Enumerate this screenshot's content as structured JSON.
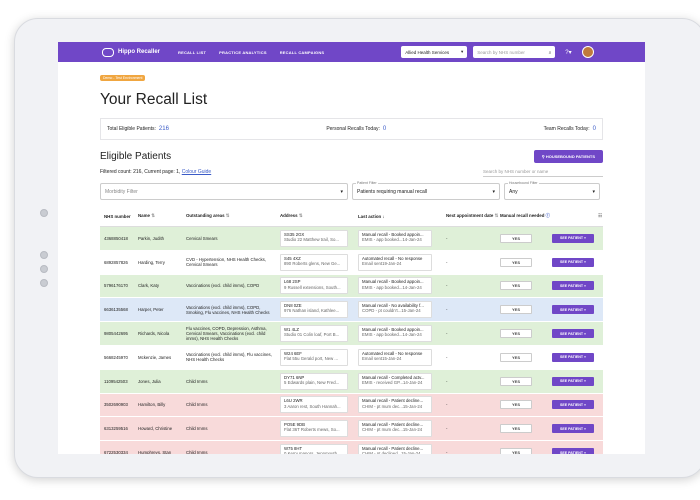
{
  "nav": {
    "brand": "Hippo Recaller",
    "links": [
      "RECALL LIST",
      "PRACTICE ANALYTICS",
      "RECALL CAMPAIGNS"
    ],
    "org": "Allied Health Services",
    "search_placeholder": "Search by NHS number"
  },
  "env": "Demo - Test Environment",
  "title": "Your Recall List",
  "stats": {
    "total_label": "Total Eligible Patients:",
    "total": "216",
    "personal_label": "Personal Recalls Today:",
    "personal": "0",
    "team_label": "Team Recalls Today:",
    "team": "0"
  },
  "eligible": {
    "title": "Eligible Patients",
    "housebound_btn": "HOUSEBOUND PATIENTS",
    "filtered_label": "Filtered count:",
    "filtered": "216",
    "page_label": "Current page:",
    "page": "1",
    "colour_guide": "Colour Guide",
    "table_search_placeholder": "Search by NHS number or name"
  },
  "filters": {
    "morbidity_placeholder": "Morbidity Filter",
    "patient_label": "Patient Filter",
    "patient_value": "Patients requiring manual recall",
    "housebound_label": "Housebound Filter",
    "housebound_value": "Any"
  },
  "columns": {
    "nhs": "NHS number",
    "name": "Name",
    "areas": "Outstanding areas",
    "address": "Address",
    "last_action": "Last action",
    "next_appt": "Next appointment date",
    "manual": "Manual recall needed"
  },
  "colors": {
    "green": "#dff0d8",
    "blue": "#dde8f7",
    "red": "#f8dada",
    "accent": "#7047c7"
  },
  "rows": [
    {
      "color": "green",
      "nhs": "4368850418",
      "name": "Parkin, Judith",
      "areas": "Cervical Smears",
      "addr1": "SS35 2GX",
      "addr2": "Studio 22 Matthew trail, So...",
      "act1": "Manual recall - Booked appoin...",
      "act2": "EMIS - app booked...",
      "act_date": "14-Jan-24",
      "next": "-",
      "manual": "YES",
      "btn": "SEE PATIENT"
    },
    {
      "color": "white",
      "nhs": "6892857826",
      "name": "Harding, Terry",
      "areas": "CVD - Hypertension, NHS Health Checks, Cervical Smears",
      "addr1": "S45 4XZ",
      "addr2": "890 Roberts glens, New Ge...",
      "act1": "Automated recall - No response",
      "act2": "Email sent",
      "act_date": "19-Jan-24",
      "next": "-",
      "manual": "YES",
      "btn": "SEE PATIENT"
    },
    {
      "color": "green",
      "nhs": "5796176170",
      "name": "Clark, Katy",
      "areas": "Vaccinations (excl. child imms), COPD",
      "addr1": "L68 2SP",
      "addr2": "9 Russell extensions, South...",
      "act1": "Manual recall - Booked appoin...",
      "act2": "EMIS - app booked...",
      "act_date": "14-Jan-24",
      "next": "-",
      "manual": "YES",
      "btn": "SEE PATIENT"
    },
    {
      "color": "blue",
      "nhs": "6636135568",
      "name": "Harper, Peter",
      "areas": "Vaccinations (excl. child imms), COPD, Smoking, Flu vaccines, NHS Health Checks",
      "addr1": "DN8 0ZE",
      "addr2": "976 Nathan island, Kathlee...",
      "act1": "Manual recall - No availability f...",
      "act2": "COPD - pt couldn't...",
      "act_date": "15-Jan-24",
      "next": "-",
      "manual": "YES",
      "btn": "SEE PATIENT"
    },
    {
      "color": "green",
      "nhs": "9805442695",
      "name": "Richards, Nicola",
      "areas": "Flu vaccines, COPD, Depression, Asthma, Cervical Smears, Vaccinations (excl. child imms), NHS Health Checks",
      "addr1": "W1 4LZ",
      "addr2": "Studio 01 Colin loaf, Port B...",
      "act1": "Manual recall - Booked appoin...",
      "act2": "EMIS - app booked...",
      "act_date": "14-Jan-24",
      "next": "-",
      "manual": "YES",
      "btn": "SEE PATIENT"
    },
    {
      "color": "white",
      "nhs": "5668245970",
      "name": "Mckenzie, James",
      "areas": "Vaccinations (excl. child imms), Flu vaccines, NHS Health Checks",
      "addr1": "W24 6EF",
      "addr2": "Flat 55u Gerald port, New ...",
      "act1": "Automated recall - No response",
      "act2": "Email sent",
      "act_date": "15-Jan-24",
      "next": "-",
      "manual": "YES",
      "btn": "SEE PATIENT"
    },
    {
      "color": "green",
      "nhs": "1109542503",
      "name": "Jones, Julia",
      "areas": "Child Imms",
      "addr1": "DY71 6NP",
      "addr2": "5 Edwards plain, New Fred...",
      "act1": "Manual recall - Completed actv...",
      "act2": "EMIS - received GP...",
      "act_date": "14-Jan-24",
      "next": "-",
      "manual": "YES",
      "btn": "SEE PATIENT"
    },
    {
      "color": "red",
      "nhs": "3502690903",
      "name": "Hamilton, Billy",
      "areas": "Child Imms",
      "addr1": "L6U 2WR",
      "addr2": "3 Aaron rest, South Hannah...",
      "act1": "Manual recall - Patient decline...",
      "act2": "CHIM - pt mum dec...",
      "act_date": "15-Jan-24",
      "next": "-",
      "manual": "YES",
      "btn": "SEE PATIENT"
    },
    {
      "color": "red",
      "nhs": "6313259516",
      "name": "Howard, Christine",
      "areas": "Child Imms",
      "addr1": "PO5E 9DB",
      "addr2": "Flat 36T Roberts mews, So...",
      "act1": "Manual recall - Patient decline...",
      "act2": "CHIM - pt mum dec...",
      "act_date": "15-Jan-24",
      "next": "-",
      "manual": "YES",
      "btn": "SEE PATIENT"
    },
    {
      "color": "red",
      "nhs": "6722530334",
      "name": "Humphreys, Stan",
      "areas": "Child Imms",
      "addr1": "W75 8HT",
      "addr2": "0 Kerry manors, Jennmouth...",
      "act1": "Manual recall - Patient decline...",
      "act2": "CHIM - pt declined...",
      "act_date": "15-Jan-24",
      "next": "-",
      "manual": "YES",
      "btn": "SEE PATIENT"
    }
  ]
}
